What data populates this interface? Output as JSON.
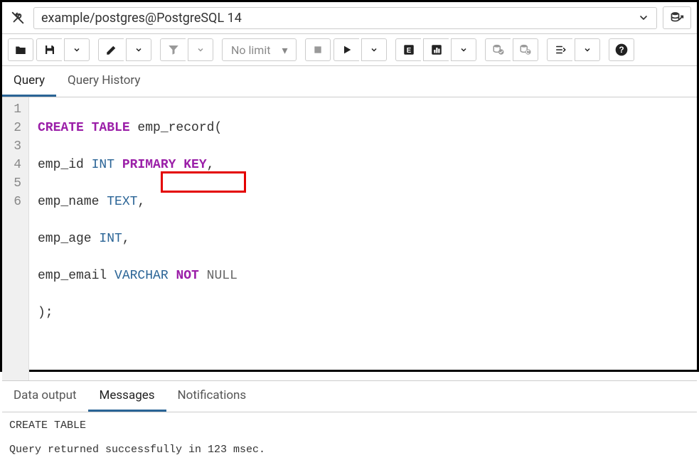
{
  "connection": {
    "text": "example/postgres@PostgreSQL 14"
  },
  "toolbar": {
    "limit_label": "No limit"
  },
  "tabs": {
    "query": "Query",
    "history": "Query History"
  },
  "editor": {
    "lines": [
      "1",
      "2",
      "3",
      "4",
      "5",
      "6"
    ],
    "code": {
      "l1_kw": "CREATE TABLE",
      "l1_id": " emp_record(",
      "l2_id": "emp_id ",
      "l2_ty": "INT",
      "l2_kw": " PRIMARY KEY",
      "l2c": ",",
      "l3_id": "emp_name ",
      "l3_ty": "TEXT",
      "l3c": ",",
      "l4_id": "emp_age ",
      "l4_ty": "INT",
      "l4c": ",",
      "l5_id": "emp_email ",
      "l5_ty": "VARCHAR",
      "l5_kw": " NOT",
      "l5_nn": " NULL",
      "l6": ");"
    }
  },
  "output_tabs": {
    "data": "Data output",
    "messages": "Messages",
    "notifications": "Notifications"
  },
  "output": {
    "text": "CREATE TABLE\n\nQuery returned successfully in 123 msec."
  }
}
